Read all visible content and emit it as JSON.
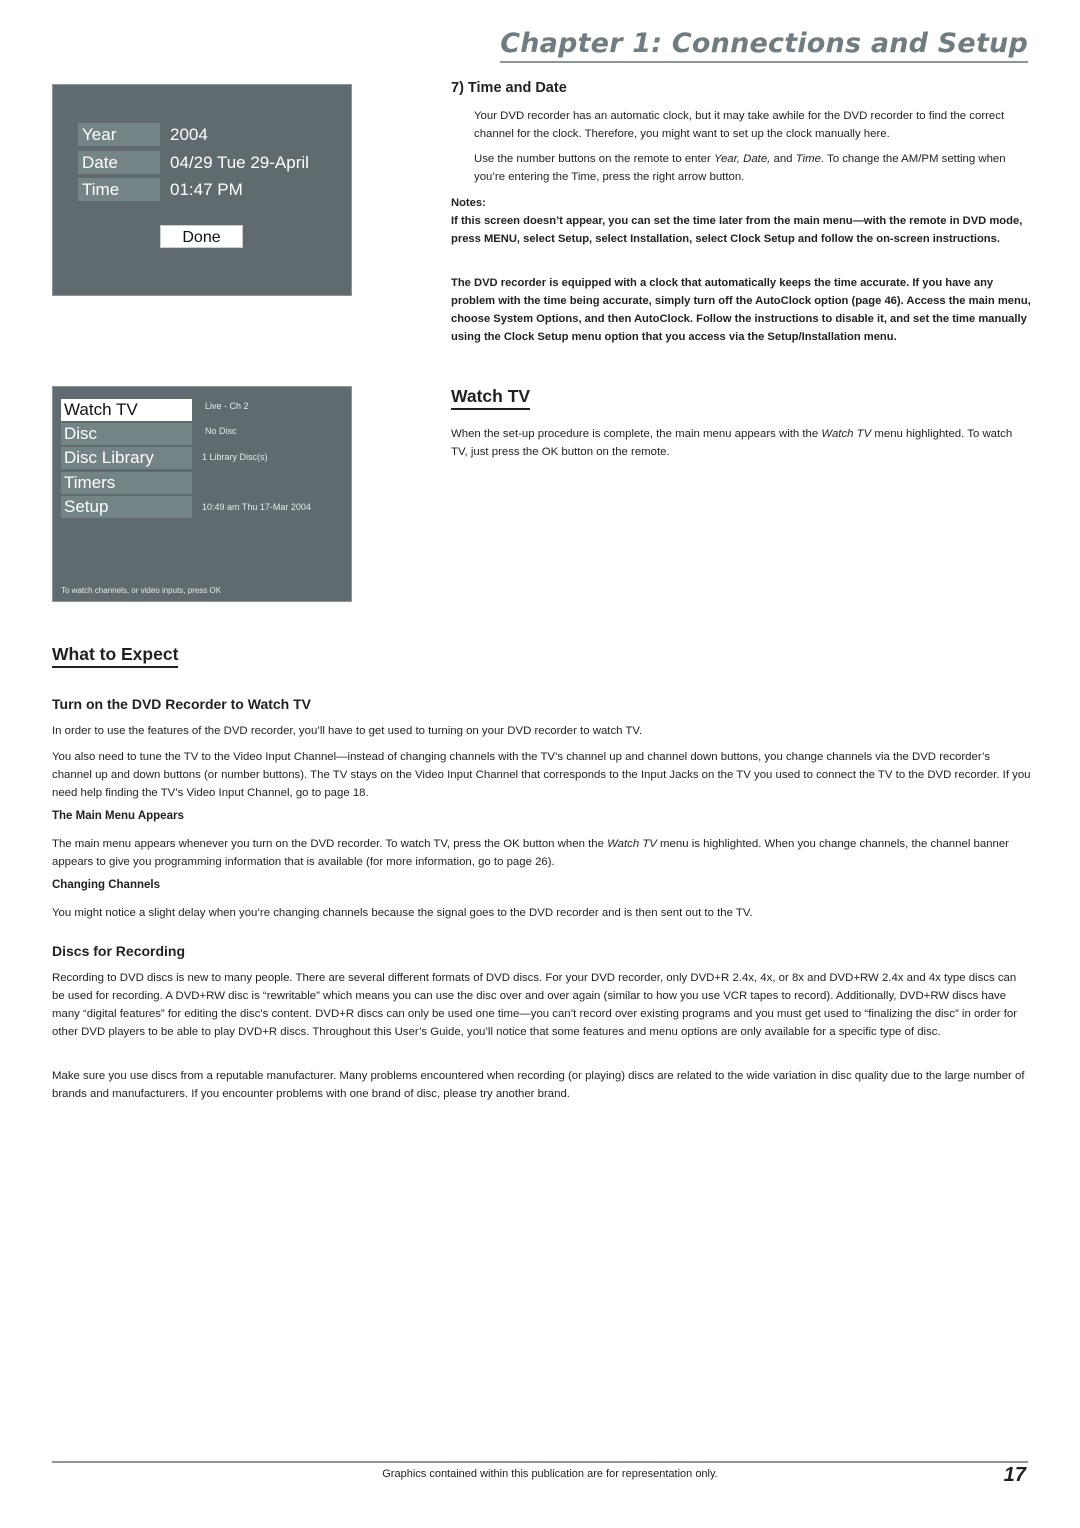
{
  "header": {
    "chapter_title": "Chapter 1: Connections and Setup"
  },
  "clock_screen": {
    "rows": [
      {
        "label": "Year",
        "value": "2004"
      },
      {
        "label": "Date",
        "value": "04/29 Tue 29-April"
      },
      {
        "label": "Time",
        "value": "01:47 PM"
      }
    ],
    "done_label": "Done"
  },
  "menu_screen": {
    "items": [
      {
        "label": "Watch TV",
        "info": "Live - Ch 2",
        "selected": true
      },
      {
        "label": "Disc",
        "info": "No Disc"
      },
      {
        "label": "Disc Library",
        "info": "1 Library Disc(s)"
      },
      {
        "label": "Timers",
        "info": ""
      },
      {
        "label": "Setup",
        "info": "10:49 am Thu 17-Mar 2004"
      }
    ],
    "hint": "To watch channels, or video inputs, press OK"
  },
  "time_and_date": {
    "heading": "7) Time and Date",
    "p1": "Your DVD recorder has an automatic clock, but it may take awhile for the DVD recorder to find the correct channel for the clock. Therefore, you might want to set up the clock manually here.",
    "p2_a": "Use the number buttons on the remote to enter ",
    "p2_em": "Year, Date,",
    "p2_b": " and ",
    "p2_em2": "Time",
    "p2_c": ". To change the AM/PM setting when you’re entering the Time, press the right arrow button.",
    "notes_label": "Notes:",
    "note1": "If this screen doesn’t appear, you can set the time later from the main menu—with the remote in DVD mode, press MENU, select Setup, select Installation, select Clock Setup and follow the on-screen instructions.",
    "note2": "The DVD recorder is equipped with a clock that automatically keeps the time accurate. If you have any problem with the time being accurate, simply turn off the AutoClock option (page 46). Access the main menu, choose System Options, and then AutoClock. Follow the instructions to disable it, and set the time manually using the Clock Setup menu option that you access via the Setup/Installation menu."
  },
  "watch_tv": {
    "heading": "Watch TV",
    "p_a": "When the set-up procedure is complete, the main menu appears with the ",
    "p_em": "Watch TV",
    "p_b": " menu highlighted. To watch TV, just press the OK button on the remote."
  },
  "what_to_expect": {
    "heading": "What to Expect",
    "turn_on": {
      "heading": "Turn on the DVD Recorder to Watch TV",
      "p1": "In order to use the features of the DVD recorder, you’ll have to get used to turning on your DVD recorder to watch TV.",
      "p2": "You also need to tune the TV to the Video Input Channel—instead of changing channels with the TV’s channel up and channel down buttons, you change channels via the DVD recorder’s channel up and down buttons (or number buttons). The TV stays on the Video Input Channel that corresponds to the Input Jacks on the TV you used to connect the TV to the DVD recorder. If you need help finding the TV’s Video Input Channel, go to page 18."
    },
    "main_menu": {
      "heading": "The Main Menu Appears",
      "p_a": "The main menu appears whenever you turn on the DVD recorder. To watch TV, press the OK button when the ",
      "p_em": "Watch TV",
      "p_b": " menu is highlighted. When you change channels, the channel banner appears to give you programming information that is available (for more information, go to page 26)."
    },
    "changing_channels": {
      "heading": "Changing Channels",
      "p": "You might notice a slight delay when you’re changing channels because the signal goes to the DVD recorder and is then sent out to the TV."
    },
    "discs": {
      "heading": "Discs for Recording",
      "p1": "Recording to DVD discs is new to many people. There are several different formats of DVD discs. For your DVD recorder, only DVD+R 2.4x, 4x, or 8x and DVD+RW 2.4x and 4x type discs can be used for recording. A DVD+RW disc is “rewritable” which means you can use the disc over and over again (similar to how you use VCR tapes to record). Additionally, DVD+RW discs have many “digital features” for editing the disc’s content. DVD+R discs can only be used one time—you can’t record over existing programs and you must get used to “finalizing the disc” in order for other DVD players to be able to play DVD+R discs. Throughout this User’s Guide, you’ll notice that some features and menu options are only available for a specific type of disc.",
      "p2": "Make sure you use discs from a reputable manufacturer. Many problems encountered when recording (or playing) discs are related to the wide variation in disc quality due to the large number of brands and manufacturers. If you encounter problems with one brand of disc, please try another brand."
    }
  },
  "footer": {
    "note": "Graphics contained within this publication are for representation only.",
    "page_number": "17"
  }
}
